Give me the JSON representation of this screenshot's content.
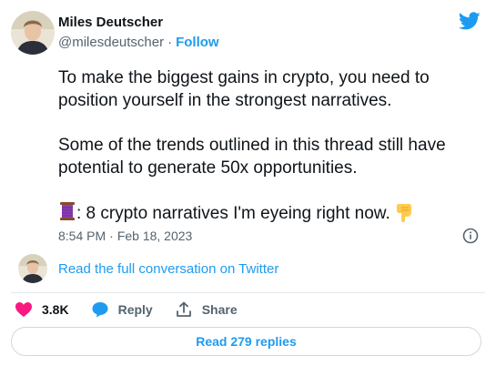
{
  "author": {
    "name": "Miles Deutscher",
    "handle": "@milesdeutscher",
    "separator": "·",
    "follow_label": "Follow"
  },
  "tweet": {
    "paragraph_1": "To make the biggest gains in crypto, you need to position yourself in the strongest narratives.",
    "paragraph_2": "Some of the trends outlined in this thread still have potential to generate 50x opportunities.",
    "paragraph_3": ": 8 crypto narratives I'm eyeing right now.",
    "time": "8:54 PM",
    "date": "Feb 18, 2023"
  },
  "read_conversation_label": "Read the full conversation on Twitter",
  "actions": {
    "likes": "3.8K",
    "reply_label": "Reply",
    "share_label": "Share"
  },
  "replies_button_label": "Read 279 replies",
  "colors": {
    "accent": "#1d9bf0",
    "like_red": "#f91880",
    "text": "#0f1419",
    "muted": "#536471"
  },
  "icons": [
    "twitter-logo-icon",
    "thread-spool-icon",
    "pointing-down-hand-icon",
    "info-icon",
    "heart-icon",
    "reply-bubble-icon",
    "share-icon"
  ]
}
